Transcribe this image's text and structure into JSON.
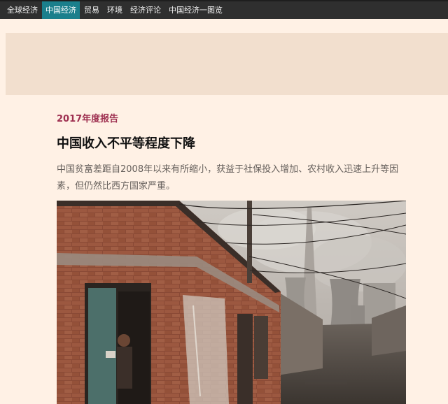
{
  "nav": {
    "items": [
      {
        "label": "全球经济",
        "active": false
      },
      {
        "label": "中国经济",
        "active": true
      },
      {
        "label": "贸易",
        "active": false
      },
      {
        "label": "环境",
        "active": false
      },
      {
        "label": "经济评论",
        "active": false
      },
      {
        "label": "中国经济一图览",
        "active": false
      }
    ]
  },
  "article": {
    "kicker": "2017年度报告",
    "headline": "中国收入不平等程度下降",
    "standfirst": "中国贫富差距自2008年以来有所缩小，获益于社保投入增加、农村收入迅速上升等因素，但仍然比西方国家严重。"
  },
  "colors": {
    "page_bg": "#fff1e5",
    "nav_bg": "#2f2f2f",
    "nav_active": "#1b7f8c",
    "kicker": "#9e2f50"
  }
}
